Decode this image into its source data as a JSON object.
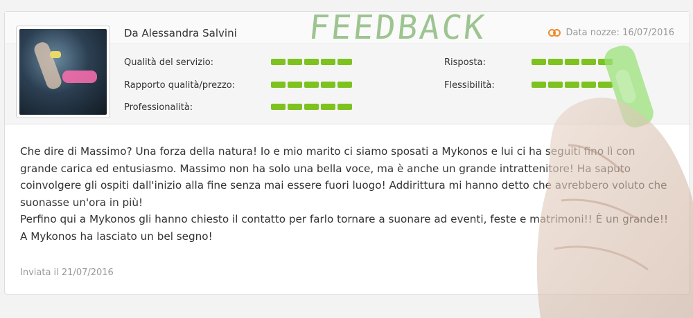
{
  "header": {
    "author": "Da Alessandra Salvini",
    "wedding_date": "Data nozze: 16/07/2016"
  },
  "ratings": {
    "left": [
      {
        "label": "Qualità del servizio:",
        "score": 5,
        "max": 5
      },
      {
        "label": "Rapporto qualità/prezzo:",
        "score": 5,
        "max": 5
      },
      {
        "label": "Professionalità:",
        "score": 5,
        "max": 5
      }
    ],
    "right": [
      {
        "label": "Risposta:",
        "score": 5,
        "max": 5
      },
      {
        "label": "Flessibilità:",
        "score": 5,
        "max": 5
      }
    ]
  },
  "review": {
    "paragraph1": "Che dire di Massimo? Una forza della natura! Io e mio marito ci siamo sposati a Mykonos e lui ci ha seguiti fino lì con grande carica ed entusiasmo. Massimo non ha solo una bella voce, ma è anche un grande intrattenitore! Ha saputo coinvolgere gli ospiti dall'inizio alla fine senza mai essere fuori luogo! Addirittura mi hanno detto che avrebbero voluto che suonasse un'ora in più!",
    "paragraph2": "Perfino qui a Mykonos gli hanno chiesto il contatto per farlo tornare a suonare ad eventi, feste e matrimoni!! È un grande!! A Mykonos ha lasciato un bel segno!",
    "sent": "Inviata il 21/07/2016"
  },
  "overlay": {
    "title": "FEEDBACK"
  },
  "colors": {
    "rating_bar": "#7dc21e",
    "rings": "#f08a2a",
    "overlay_text": "#7fb36e"
  }
}
